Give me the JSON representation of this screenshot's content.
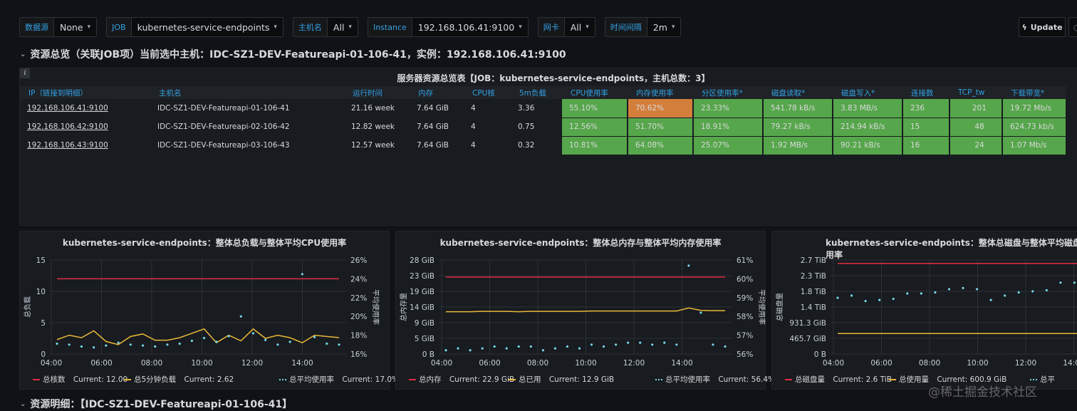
{
  "variables": [
    {
      "label": "数据源",
      "value": "None"
    },
    {
      "label": "JOB",
      "value": "kubernetes-service-endpoints"
    },
    {
      "label": "主机名",
      "value": "All"
    },
    {
      "label": "Instance",
      "value": "192.168.106.41:9100"
    },
    {
      "label": "网卡",
      "value": "All"
    },
    {
      "label": "时间间隔",
      "value": "2m"
    }
  ],
  "update_label": "Update",
  "row1_title": "资源总览（关联JOB项）当前选中主机：IDC-SZ1-DEV-Featureapi-01-106-41，实例：192.168.106.41:9100",
  "row2_title": "资源明细：【IDC-SZ1-DEV-Featureapi-01-106-41】",
  "table": {
    "title": "服务器资源总览表【JOB：kubernetes-service-endpoints，主机总数：3】",
    "columns": [
      "IP（链接到明细）",
      "主机名",
      "运行时间",
      "内存",
      "CPU核",
      "5m负载",
      "CPU使用率",
      "内存使用率",
      "分区使用率*",
      "磁盘读取*",
      "磁盘写入*",
      "连接数",
      "TCP_tw",
      "下载带宽*"
    ],
    "rows": [
      [
        "192.168.106.41:9100",
        "IDC-SZ1-DEV-Featureapi-01-106-41",
        "21.16 week",
        "7.64 GiB",
        "4",
        "3.36",
        "55.10%",
        "70.62%",
        "23.33%",
        "541.78 kB/s",
        "3.83 MB/s",
        "236",
        "201",
        "19.72 Mb/s"
      ],
      [
        "192.168.106.42:9100",
        "IDC-SZ1-DEV-Featureapi-02-106-42",
        "12.82 week",
        "7.64 GiB",
        "4",
        "0.75",
        "12.56%",
        "51.70%",
        "18.91%",
        "79.27 kB/s",
        "214.94 kB/s",
        "15",
        "48",
        "624.73 kb/s"
      ],
      [
        "192.168.106.43:9100",
        "IDC-SZ1-DEV-Featureapi-03-106-43",
        "12.57 week",
        "7.64 GiB",
        "4",
        "0.32",
        "10.81%",
        "64.08%",
        "25.07%",
        "1.92 MB/s",
        "90.21 kB/s",
        "16",
        "24",
        "1.07 Mb/s"
      ]
    ]
  },
  "colors": {
    "green": "#56a64b",
    "orange": "#d47e3c",
    "red": "#e02f44",
    "yellow": "#eab839",
    "cyan": "#73d7e7",
    "link": "#33a2e5"
  },
  "charts": [
    {
      "title": "kubernetes-service-endpoints：整体总负载与整体平均CPU使用率",
      "left_axis_label": "总负载",
      "right_axis_label": "平均使用率",
      "left_ticks": [
        "15",
        "10",
        "5",
        "0"
      ],
      "right_ticks": [
        "26%",
        "24%",
        "22%",
        "20%",
        "18%",
        "16%"
      ],
      "x_ticks": [
        "04:00",
        "06:00",
        "08:00",
        "10:00",
        "12:00",
        "14:00"
      ],
      "legend": [
        {
          "name": "总核数",
          "current": "Current: 12.00",
          "color": "#e02f44",
          "style": "line"
        },
        {
          "name": "总5分钟负载",
          "current": "Current: 2.62",
          "color": "#eab839",
          "style": "line"
        },
        {
          "name": "总平均使用率",
          "current": "Current: 17.0%",
          "color": "#73d7e7",
          "style": "points"
        }
      ]
    },
    {
      "title": "kubernetes-service-endpoints：整体总内存与整体平均内存使用率",
      "left_axis_label": "总内存量",
      "right_axis_label": "平均使用率",
      "left_ticks": [
        "28 GiB",
        "23 GiB",
        "19 GiB",
        "14 GiB",
        "9 GiB",
        "5 GiB",
        "0 B"
      ],
      "right_ticks": [
        "61%",
        "60%",
        "59%",
        "58%",
        "57%",
        "56%"
      ],
      "x_ticks": [
        "04:00",
        "06:00",
        "08:00",
        "10:00",
        "12:00",
        "14:00"
      ],
      "legend": [
        {
          "name": "总内存",
          "current": "Current: 22.9 GiB",
          "color": "#e02f44",
          "style": "line"
        },
        {
          "name": "总已用",
          "current": "Current: 12.9 GiB",
          "color": "#eab839",
          "style": "line"
        },
        {
          "name": "总平均使用率",
          "current": "Current: 56.4%",
          "color": "#73d7e7",
          "style": "points"
        }
      ]
    },
    {
      "title": "kubernetes-service-endpoints：整体总磁盘与整体平均磁盘使用率",
      "left_axis_label": "总磁盘量",
      "right_axis_label": "",
      "left_ticks": [
        "2.7 TiB",
        "2.3 TiB",
        "1.8 TiB",
        "1.4 TiB",
        "931.3 GiB",
        "465.7 GiB",
        "0 B"
      ],
      "right_ticks": [],
      "x_ticks": [
        "04:00",
        "06:00",
        "08:00",
        "10:00",
        "12:00",
        "14:00"
      ],
      "legend": [
        {
          "name": "总磁盘量",
          "current": "Current: 2.6 TiB",
          "color": "#e02f44",
          "style": "line"
        },
        {
          "name": "总使用量",
          "current": "Current: 600.9 GiB",
          "color": "#eab839",
          "style": "line"
        },
        {
          "name": "总平",
          "current": "",
          "color": "#73d7e7",
          "style": "points"
        }
      ]
    }
  ],
  "chart_data": [
    {
      "type": "line",
      "title": "kubernetes-service-endpoints：整体总负载与整体平均CPU使用率",
      "x": [
        "03:45",
        "04:15",
        "04:45",
        "05:15",
        "05:45",
        "06:15",
        "06:45",
        "07:15",
        "07:45",
        "08:15",
        "08:45",
        "09:15",
        "09:45",
        "10:15",
        "10:45",
        "11:15",
        "11:45",
        "12:15",
        "12:45",
        "13:15",
        "13:45",
        "14:15",
        "14:45",
        "15:15"
      ],
      "series": [
        {
          "name": "总核数",
          "axis": "left",
          "values": [
            12,
            12,
            12,
            12,
            12,
            12,
            12,
            12,
            12,
            12,
            12,
            12,
            12,
            12,
            12,
            12,
            12,
            12,
            12,
            12,
            12,
            12,
            12,
            12
          ]
        },
        {
          "name": "总5分钟负载",
          "axis": "left",
          "values": [
            2.3,
            3.0,
            2.6,
            3.7,
            2.0,
            1.5,
            2.8,
            3.2,
            2.2,
            2.2,
            2.6,
            3.3,
            4.0,
            1.8,
            3.0,
            2.1,
            4.0,
            2.5,
            3.0,
            2.6,
            1.8,
            3.0,
            2.8,
            2.62
          ]
        },
        {
          "name": "总平均使用率",
          "axis": "right",
          "values": [
            17.1,
            17.0,
            16.8,
            16.7,
            16.9,
            17.2,
            17.0,
            16.9,
            16.8,
            17.0,
            17.1,
            17.4,
            17.7,
            17.3,
            17.9,
            20.0,
            18.2,
            17.5,
            17.0,
            17.3,
            24.5,
            17.8,
            17.1,
            17.0
          ]
        }
      ],
      "ylim_left": [
        0,
        15
      ],
      "ylim_right": [
        16,
        26
      ]
    },
    {
      "type": "line",
      "title": "kubernetes-service-endpoints：整体总内存与整体平均内存使用率",
      "x": [
        "03:45",
        "04:15",
        "04:45",
        "05:15",
        "05:45",
        "06:15",
        "06:45",
        "07:15",
        "07:45",
        "08:15",
        "08:45",
        "09:15",
        "09:45",
        "10:15",
        "10:45",
        "11:15",
        "11:45",
        "12:15",
        "12:45",
        "13:15",
        "13:45",
        "14:15",
        "14:45",
        "15:15"
      ],
      "series": [
        {
          "name": "总内存",
          "axis": "left",
          "values": [
            22.9,
            22.9,
            22.9,
            22.9,
            22.9,
            22.9,
            22.9,
            22.9,
            22.9,
            22.9,
            22.9,
            22.9,
            22.9,
            22.9,
            22.9,
            22.9,
            22.9,
            22.9,
            22.9,
            22.9,
            22.9,
            22.9,
            22.9,
            22.9
          ]
        },
        {
          "name": "总已用",
          "axis": "left",
          "values": [
            12.6,
            12.6,
            12.6,
            12.7,
            12.7,
            12.7,
            12.6,
            12.7,
            12.7,
            12.7,
            12.7,
            12.7,
            12.8,
            12.8,
            12.8,
            12.8,
            12.8,
            12.8,
            12.8,
            12.8,
            13.7,
            13.0,
            12.9,
            12.9
          ]
        },
        {
          "name": "总平均使用率",
          "axis": "right",
          "values": [
            56.2,
            56.3,
            56.2,
            56.3,
            56.4,
            56.3,
            56.4,
            56.4,
            56.2,
            56.3,
            56.4,
            56.3,
            56.5,
            56.4,
            56.5,
            56.6,
            56.6,
            56.5,
            56.6,
            56.5,
            60.7,
            58.2,
            56.5,
            56.4
          ]
        }
      ],
      "ylim_left": [
        0,
        28
      ],
      "ylim_right": [
        56,
        61
      ]
    },
    {
      "type": "line",
      "title": "kubernetes-service-endpoints：整体总磁盘与整体平均磁盘使用率",
      "x": [
        "03:45",
        "04:15",
        "04:45",
        "05:15",
        "05:45",
        "06:15",
        "06:45",
        "07:15",
        "07:45",
        "08:15",
        "08:45",
        "09:15",
        "09:45",
        "10:15",
        "10:45",
        "11:15",
        "11:45",
        "12:15",
        "12:45",
        "13:15",
        "13:45",
        "14:15",
        "14:45",
        "15:15"
      ],
      "series": [
        {
          "name": "总磁盘量",
          "axis": "left",
          "values": [
            2.6,
            2.6,
            2.6,
            2.6,
            2.6,
            2.6,
            2.6,
            2.6,
            2.6,
            2.6,
            2.6,
            2.6,
            2.6,
            2.6,
            2.6,
            2.6,
            2.6,
            2.6,
            2.6,
            2.6,
            2.6,
            2.6,
            2.6,
            2.6
          ]
        },
        {
          "name": "总使用量",
          "axis": "left",
          "values": [
            0.587,
            0.587,
            0.587,
            0.587,
            0.587,
            0.587,
            0.587,
            0.587,
            0.587,
            0.587,
            0.587,
            0.587,
            0.587,
            0.587,
            0.587,
            0.587,
            0.587,
            0.587,
            0.587,
            0.587,
            0.587,
            0.587,
            0.587,
            0.587
          ]
        }
      ],
      "ylim_left": [
        0,
        2.7
      ]
    }
  ],
  "watermark": "@稀土掘金技术社区"
}
